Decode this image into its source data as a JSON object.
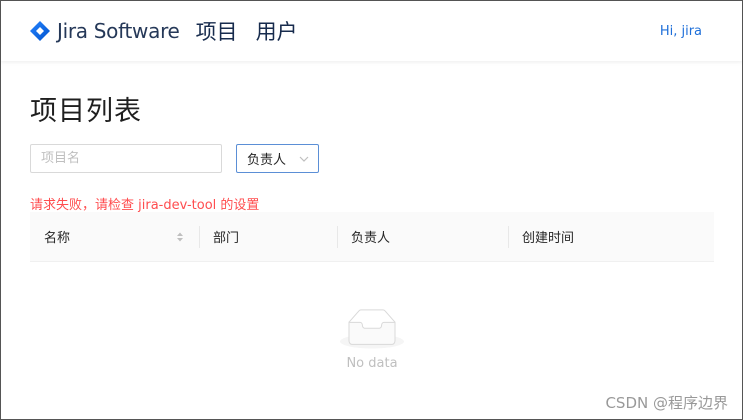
{
  "header": {
    "brand": "Jira Software",
    "nav": [
      {
        "label": "项目"
      },
      {
        "label": "用户"
      }
    ],
    "user_greeting": "Hi, jira"
  },
  "page": {
    "title": "项目列表"
  },
  "filters": {
    "name_placeholder": "项目名",
    "owner_select_value": "负责人"
  },
  "error": {
    "message": "请求失败，请检查 jira-dev-tool 的设置"
  },
  "table": {
    "columns": [
      {
        "label": "名称",
        "sortable": true
      },
      {
        "label": "部门"
      },
      {
        "label": "负责人"
      },
      {
        "label": "创建时间"
      }
    ],
    "rows": [],
    "empty_text": "No data"
  },
  "watermark": "CSDN @程序边界",
  "colors": {
    "brand_blue": "#2684ff",
    "link_blue": "#1e6fd9",
    "error_red": "#ff4d4f",
    "table_header_bg": "#fafafa"
  },
  "icons": {
    "brand": "jira-logo-icon",
    "select_arrow": "chevron-down-icon",
    "sort": "sort-icon",
    "empty": "empty-box-icon"
  }
}
